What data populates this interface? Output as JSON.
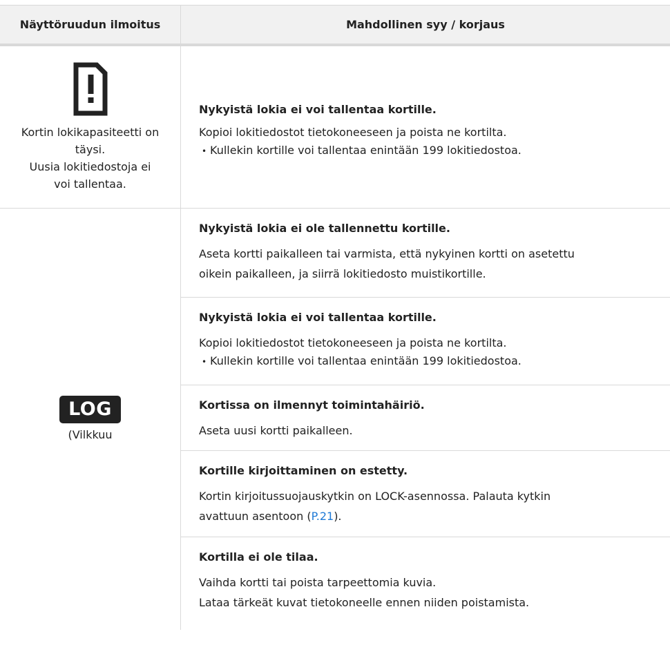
{
  "header": {
    "col1": "Näyttöruudun ilmoitus",
    "col2": "Mahdollinen syy / korjaus"
  },
  "row1": {
    "icon": "card-warning-icon",
    "message_lines": [
      "Kortin lokikapasiteetti on",
      "täysi.",
      "Uusia lokitiedostoja ei",
      "voi tallentaa."
    ],
    "entry": {
      "title": "Nykyistä lokia ei voi tallentaa kortille.",
      "text": "Kopioi lokitiedostot tietokoneeseen ja poista ne kortilta.",
      "bullet": "Kullekin kortille voi tallentaa enintään 199 lokitiedostoa."
    }
  },
  "row2": {
    "badge": "LOG",
    "badge_note": "(Vilkkuu",
    "entries": [
      {
        "title": "Nykyistä lokia ei ole tallennettu kortille.",
        "lines": [
          "Aseta kortti paikalleen tai varmista, että nykyinen kortti on asetettu",
          "oikein paikalleen, ja siirrä lokitiedosto muistikortille."
        ]
      },
      {
        "title": "Nykyistä lokia ei voi tallentaa kortille.",
        "lines": [
          "Kopioi lokitiedostot tietokoneeseen ja poista ne kortilta."
        ],
        "bullet": "Kullekin kortille voi tallentaa enintään 199 lokitiedostoa."
      },
      {
        "title": "Kortissa on ilmennyt toimintahäiriö.",
        "lines": [
          "Aseta uusi kortti paikalleen."
        ]
      },
      {
        "title": "Kortille kirjoittaminen on estetty.",
        "line1": "Kortin kirjoitussuojauskytkin on LOCK-asennossa. Palauta kytkin",
        "line2_prefix": "avattuun asentoon (",
        "link": "P.21",
        "line2_suffix": ")."
      },
      {
        "title": "Kortilla ei ole tilaa.",
        "lines": [
          "Vaihda kortti tai poista tarpeettomia kuvia.",
          "Lataa tärkeät kuvat tietokoneelle ennen niiden poistamista."
        ]
      }
    ]
  },
  "colors": {
    "header_bg": "#f1f1f1",
    "border": "#d9d9d9",
    "link": "#1f7ad6",
    "badge_bg": "#222222"
  }
}
